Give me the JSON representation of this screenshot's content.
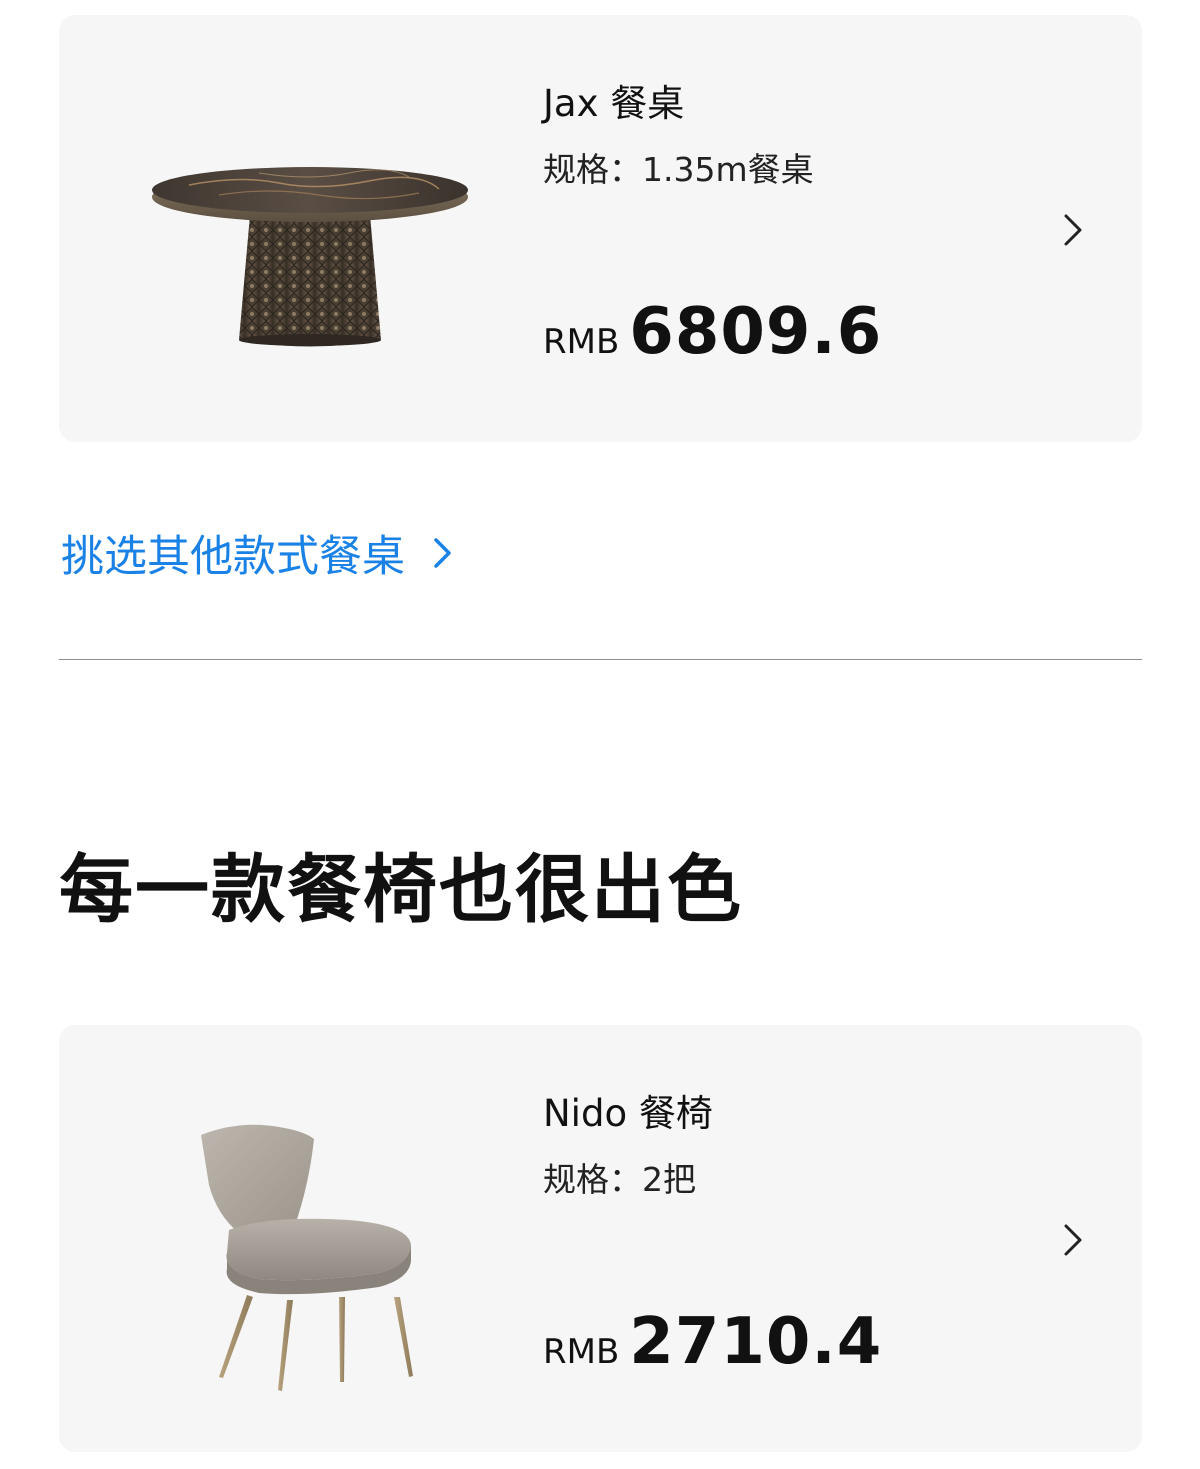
{
  "table_product": {
    "title": "Jax 餐桌",
    "spec": "规格：1.35m餐桌",
    "currency": "RMB",
    "price": "6809.6",
    "image_icon": "round-dining-table-image",
    "chevron_icon": "chevron-right-icon"
  },
  "other_tables_link": {
    "label": "挑选其他款式餐桌",
    "color": "#1a82e6",
    "chevron_icon": "chevron-right-icon"
  },
  "chairs_section": {
    "heading": "每一款餐椅也很出色"
  },
  "chair_product": {
    "title": "Nido 餐椅",
    "spec": "规格：2把",
    "currency": "RMB",
    "price": "2710.4",
    "image_icon": "upholstered-dining-chair-image",
    "chevron_icon": "chevron-right-icon"
  },
  "colors": {
    "card_background": "#f6f6f6",
    "link_blue": "#1a82e6",
    "text_primary": "#111111",
    "divider": "#8c8c8c"
  }
}
